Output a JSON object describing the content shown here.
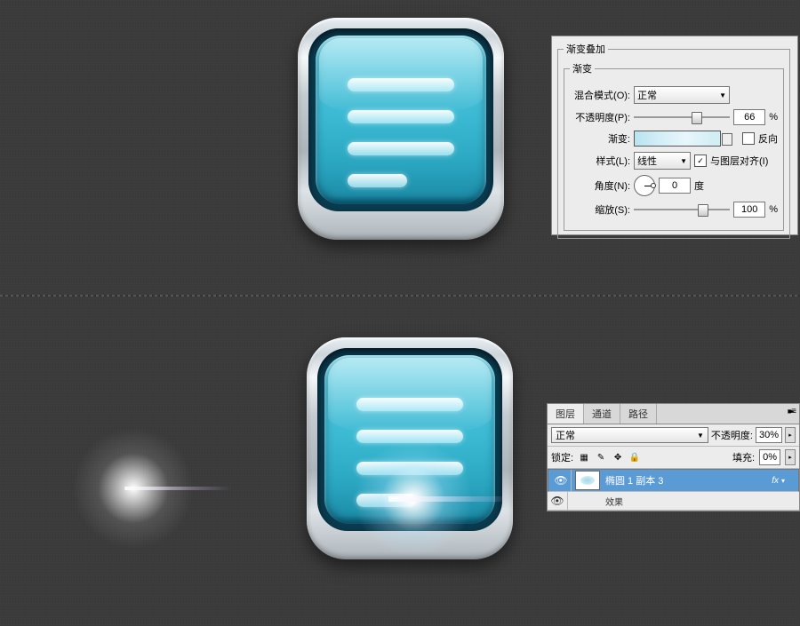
{
  "gradientPanel": {
    "groupTitle": "渐变叠加",
    "subTitle": "渐变",
    "blendModeLabel": "混合模式(O):",
    "blendModeValue": "正常",
    "opacityLabel": "不透明度(P):",
    "opacityValue": "66",
    "opacityUnit": "%",
    "gradientLabel": "渐变:",
    "reverseLabel": "反向",
    "styleLabel": "样式(L):",
    "styleValue": "线性",
    "alignLabel": "与图层对齐(I)",
    "alignChecked": "✓",
    "angleLabel": "角度(N):",
    "angleValue": "0",
    "angleUnit": "度",
    "scaleLabel": "缩放(S):",
    "scaleValue": "100",
    "scaleUnit": "%"
  },
  "layersPanel": {
    "tabs": {
      "layers": "图层",
      "channels": "通道",
      "paths": "路径"
    },
    "blendMode": "正常",
    "opacityLabel": "不透明度:",
    "opacityValue": "30%",
    "lockLabel": "锁定:",
    "fillLabel": "填充:",
    "fillValue": "0%",
    "layerName": "椭圆 1 副本 3",
    "fxLabel": "fx",
    "subLayer": "效果"
  }
}
